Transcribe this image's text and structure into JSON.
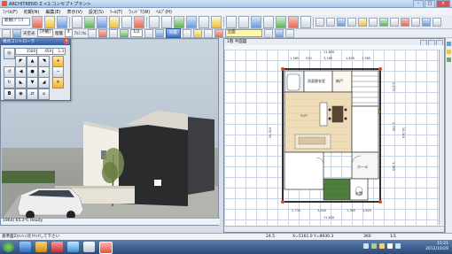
{
  "window": {
    "title": "ARCHITREND Z <1:コンセプトプラン>"
  },
  "menu": [
    "ﾌｧｲﾙ(F)",
    "初期(N)",
    "編集(E)",
    "表示(V)",
    "設定(S)",
    "ﾂｰﾙ(T)",
    "ｳｨﾝﾄﾞｳ(W)",
    "ﾍﾙﾌﾟ(H)"
  ],
  "toolbar1": {
    "combo": "新規(ﾌﾟﾗﾝ)"
  },
  "toolbar2": {
    "type_label": "天空光",
    "type_value": "[外観]",
    "floor_label": "階層",
    "floor_value": "4",
    "layer_label": "ｱﾙﾐﾆｳﾑ",
    "zoom": "1/2",
    "view_button": "光漏",
    "plan_value": "立面"
  },
  "panel": {
    "title": "視点コントローラ",
    "field1": "1500",
    "field2": "459",
    "field3": "1.3"
  },
  "left_status": "1964) 65.3℃  Ready",
  "plan_window": {
    "title": "1階 平面図"
  },
  "dims": {
    "top_total": "11,830",
    "top_segments": [
      "1,365",
      "910",
      "3,185",
      "1,820",
      "1,365"
    ],
    "bottom_total": "11,830",
    "bottom_segments": [
      "2,730",
      "3,640",
      "1,365",
      "1,820"
    ],
    "right_total": "10,010",
    "right_segments": [
      "2,275",
      "2,730",
      "1,365"
    ],
    "left_total": "10,010"
  },
  "rooms": {
    "washroom": "洗面脱衣室",
    "storage": "納戸",
    "kitchen": "ｷｯﾁﾝ",
    "hall": "ホール",
    "entrance": "玄関"
  },
  "statusbar": {
    "left": "基準面Z(ﾒｯｼｭ)をｸﾘｯｸして下さい",
    "coords1": "24.5",
    "coords2": "X=5161.0  Y=8930.3",
    "coords3": "360",
    "coords4": "1/1"
  },
  "clock": {
    "time": "15:21",
    "date": "2012/10/29"
  },
  "colors": {
    "accent": "#2f5aa3",
    "taskbar": "#2c4a78",
    "wall": "#444444"
  }
}
